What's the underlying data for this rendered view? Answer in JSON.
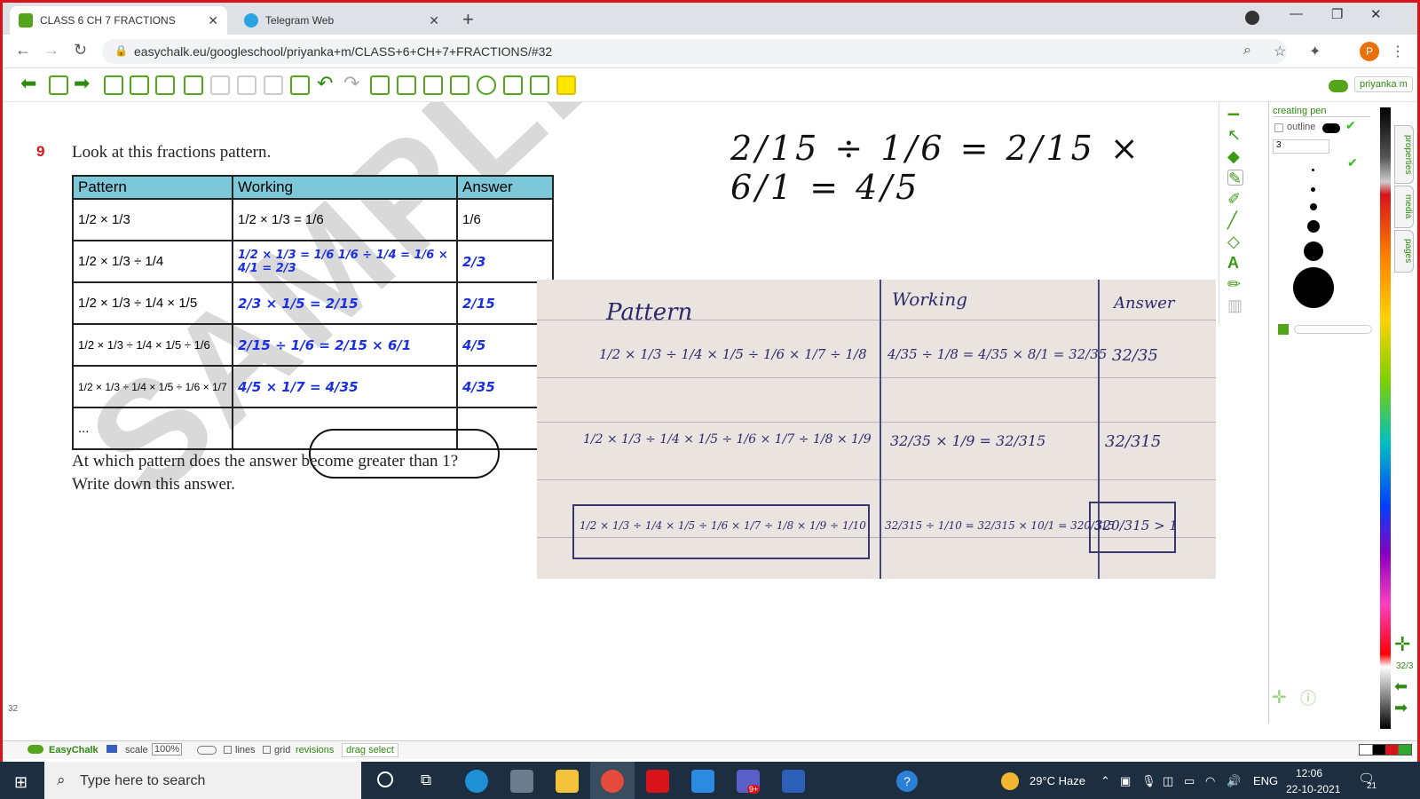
{
  "browser": {
    "tabs": [
      {
        "label": "CLASS 6 CH 7 FRACTIONS"
      },
      {
        "label": "Telegram Web"
      }
    ],
    "url": "easychalk.eu/googleschool/priyanka+m/CLASS+6+CH+7+FRACTIONS/#32",
    "avatar_letter": "P"
  },
  "app": {
    "user": "priyanka m",
    "page_number": "32",
    "page_counter": "32/3"
  },
  "worksheet": {
    "watermark": "SAMPLE",
    "question_number": "9",
    "question": "Look at this fractions pattern.",
    "headers": [
      "Pattern",
      "Working",
      "Answer"
    ],
    "rows": [
      {
        "pattern": "1/2 × 1/3",
        "working": "1/2 × 1/3 = 1/6",
        "answer": "1/6"
      },
      {
        "pattern": "1/2 × 1/3 ÷ 1/4",
        "working": "1/2 × 1/3 = 1/6   1/6 ÷ 1/4 = 1/6 × 4/1 = 2/3",
        "answer": "2/3"
      },
      {
        "pattern": "1/2 × 1/3 ÷ 1/4 × 1/5",
        "working": "2/3 × 1/5 = 2/15",
        "answer": "2/15"
      },
      {
        "pattern": "1/2 × 1/3 ÷ 1/4 × 1/5 ÷ 1/6",
        "working": "2/15 ÷ 1/6 = 2/15 × 6/1",
        "answer": "4/5"
      },
      {
        "pattern": "1/2 × 1/3 ÷ 1/4 × 1/5 ÷ 1/6 × 1/7",
        "working": "4/5 × 1/7 = 4/35",
        "answer": "4/35"
      },
      {
        "pattern": "...",
        "working": "",
        "answer": ""
      }
    ],
    "followup_line1": "At which pattern does the answer become greater than 1?",
    "followup_line2": "Write down this answer."
  },
  "handwriting": {
    "top_equation": "2/15 ÷ 1/6 = 2/15 × 6/1 = 4/5"
  },
  "photo_notes": {
    "headers": [
      "Pattern",
      "Working",
      "Answer"
    ],
    "rows": [
      {
        "pattern": "1/2 × 1/3 ÷ 1/4 × 1/5 ÷ 1/6 × 1/7 ÷ 1/8",
        "working": "4/35 ÷ 1/8 = 4/35 × 8/1 = 32/35",
        "answer": "32/35"
      },
      {
        "pattern": "1/2 × 1/3 ÷ 1/4 × 1/5 ÷ 1/6 × 1/7 ÷ 1/8 × 1/9",
        "working": "32/35 × 1/9 = 32/315",
        "answer": "32/315"
      },
      {
        "pattern": "1/2 × 1/3 ÷ 1/4 × 1/5 ÷ 1/6 × 1/7 ÷ 1/8 × 1/9 ÷ 1/10",
        "working": "32/315 ÷ 1/10 = 32/315 × 10/1 = 320/315",
        "answer": "320/315 > 1"
      }
    ]
  },
  "panel": {
    "title": "creating pen",
    "outline_label": "outline",
    "size_value": "3",
    "tabs": [
      "properties",
      "media",
      "pages"
    ]
  },
  "statusbar": {
    "brand": "EasyChalk",
    "scale_label": "scale",
    "scale_value": "100%",
    "lines_label": "lines",
    "grid_label": "grid",
    "revisions_label": "revisions",
    "drag_label": "drag select"
  },
  "taskbar": {
    "search_placeholder": "Type here to search",
    "weather": "29°C  Haze",
    "lang": "ENG",
    "time": "12:06",
    "date": "22-10-2021",
    "notif_count": "21",
    "teams_badge": "9+"
  }
}
